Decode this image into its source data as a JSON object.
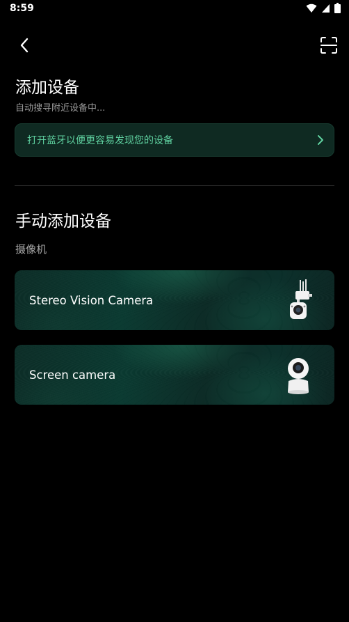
{
  "status_bar": {
    "time": "8:59"
  },
  "header": {
    "back_icon": "chevron-left-icon",
    "scan_icon": "scan-icon"
  },
  "page": {
    "title": "添加设备",
    "subtitle": "自动搜寻附近设备中..."
  },
  "bluetooth_banner": {
    "text": "打开蓝牙以便更容易发现您的设备",
    "accent": "#5fd1a0"
  },
  "manual": {
    "title": "手动添加设备",
    "category": "摄像机",
    "devices": [
      {
        "name": "Stereo Vision Camera",
        "icon": "outdoor-camera-icon"
      },
      {
        "name": "Screen camera",
        "icon": "indoor-camera-icon"
      }
    ]
  }
}
